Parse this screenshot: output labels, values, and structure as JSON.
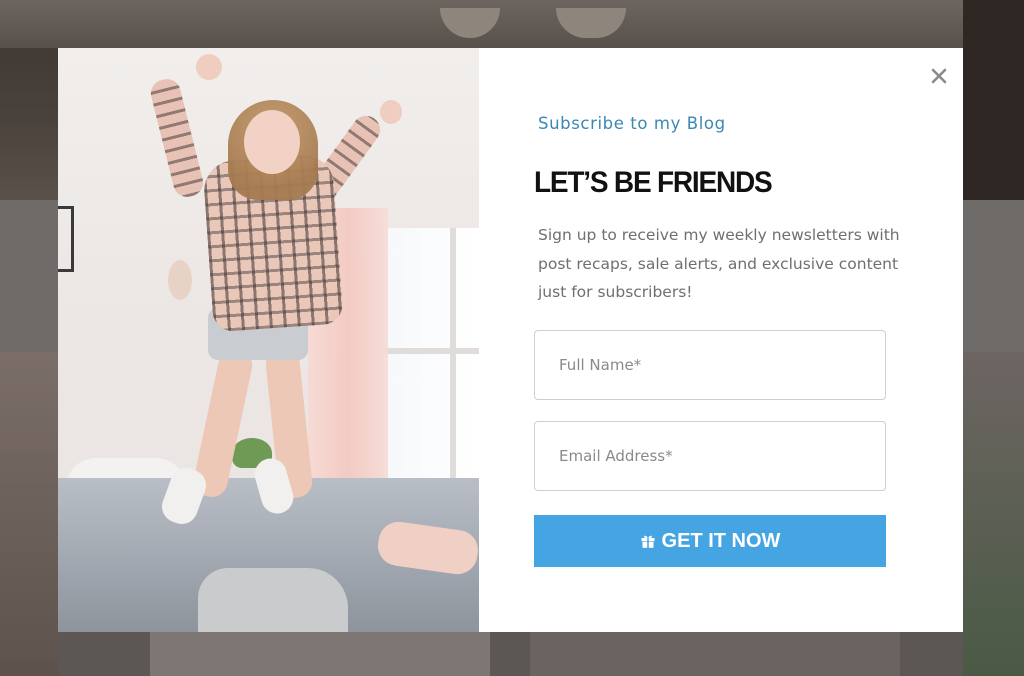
{
  "popup": {
    "kicker": "Subscribe to my Blog",
    "headline": "LET’S BE FRIENDS",
    "description": "Sign up to receive my weekly newsletters with post recaps, sale alerts, and exclusive content just for subscribers!",
    "fields": {
      "name_placeholder": "Full Name*",
      "email_placeholder": "Email Address*"
    },
    "cta_label": "GET IT NOW",
    "cta_icon": "gift-icon",
    "close_icon": "close-icon"
  },
  "colors": {
    "accent": "#45a5e3",
    "kicker": "#3d87b5",
    "headline": "#111111",
    "body_text": "#6f6f6f"
  }
}
